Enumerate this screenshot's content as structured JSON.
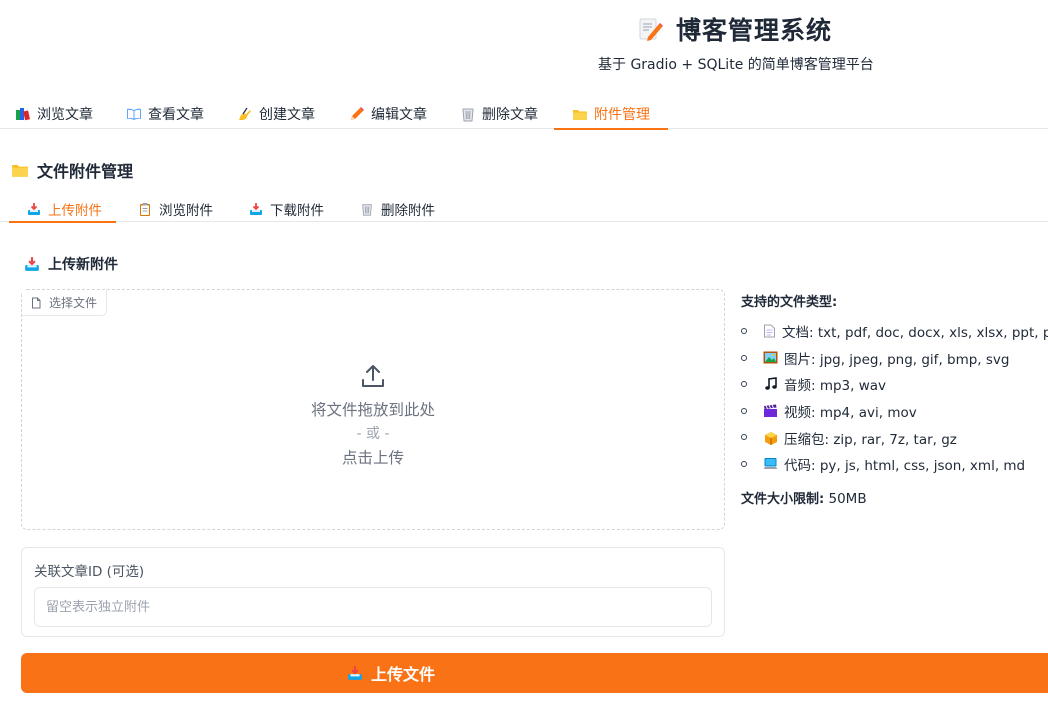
{
  "header": {
    "title": "博客管理系统",
    "subtitle": "基于 Gradio + SQLite 的简单博客管理平台",
    "title_icon": "memo-icon"
  },
  "main_tabs": [
    {
      "label": "浏览文章",
      "icon": "books-icon"
    },
    {
      "label": "查看文章",
      "icon": "open-book-icon"
    },
    {
      "label": "创建文章",
      "icon": "writing-hand-icon"
    },
    {
      "label": "编辑文章",
      "icon": "pencil-icon"
    },
    {
      "label": "删除文章",
      "icon": "wastebasket-icon"
    },
    {
      "label": "附件管理",
      "icon": "folder-icon",
      "active": true
    }
  ],
  "section": {
    "title": "文件附件管理",
    "icon": "folder-icon"
  },
  "sub_tabs": [
    {
      "label": "上传附件",
      "icon": "inbox-tray-icon",
      "active": true
    },
    {
      "label": "浏览附件",
      "icon": "clipboard-icon"
    },
    {
      "label": "下载附件",
      "icon": "inbox-tray-icon"
    },
    {
      "label": "删除附件",
      "icon": "wastebasket-icon"
    }
  ],
  "upload": {
    "heading": "上传新附件",
    "file_label": "选择文件",
    "drop_text": "将文件拖放到此处",
    "or_text": "- 或 -",
    "click_text": "点击上传"
  },
  "article_id": {
    "label": "关联文章ID (可选)",
    "placeholder": "留空表示独立附件",
    "value": ""
  },
  "supported": {
    "title": "支持的文件类型:",
    "items": [
      {
        "icon": "page-icon",
        "text": "文档: txt, pdf, doc, docx, xls, xlsx, ppt, pptx"
      },
      {
        "icon": "framed-picture-icon",
        "text": "图片: jpg, jpeg, png, gif, bmp, svg"
      },
      {
        "icon": "music-note-icon",
        "text": "音频: mp3, wav"
      },
      {
        "icon": "clapper-board-icon",
        "text": "视频: mp4, avi, mov"
      },
      {
        "icon": "package-icon",
        "text": "压缩包: zip, rar, 7z, tar, gz"
      },
      {
        "icon": "computer-icon",
        "text": "代码: py, js, html, css, json, xml, md"
      }
    ],
    "size_limit_label": "文件大小限制:",
    "size_limit_value": "50MB"
  },
  "submit": {
    "label": "上传文件",
    "icon": "inbox-tray-icon"
  },
  "colors": {
    "accent": "#f97316",
    "text": "#1f2937",
    "muted": "#6b7280",
    "border": "#e5e7eb"
  }
}
